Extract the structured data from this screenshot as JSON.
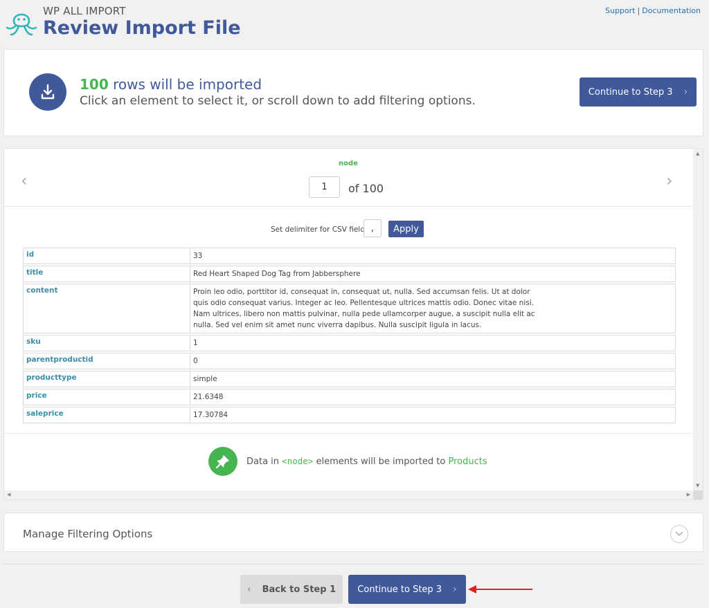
{
  "header": {
    "brand_small": "WP ALL IMPORT",
    "title": "Review Import File",
    "links": [
      "Support",
      "Documentation"
    ],
    "link_separator": "|"
  },
  "summary": {
    "count": "100",
    "line1_suffix": "rows will be imported",
    "line2": "Click an element to select it, or scroll down to add filtering options.",
    "continue_label": "Continue to Step 3",
    "icon": "download-icon"
  },
  "preview": {
    "node_name": "node",
    "current_record": "1",
    "total_text": "of 100",
    "delimiter_label": "Set delimiter for CSV fields:",
    "delimiter_value": ",",
    "apply_label": "Apply",
    "record": [
      {
        "key": "id",
        "value": "33"
      },
      {
        "key": "title",
        "value": "Red Heart Shaped Dog Tag from Jabbersphere"
      },
      {
        "key": "content",
        "value": "Proin leo odio, porttitor id, consequat in, consequat ut, nulla. Sed accumsan felis. Ut at dolor\nquis odio consequat varius. Integer ac leo. Pellentesque ultrices mattis odio. Donec vitae nisi.\nNam ultrices, libero non mattis pulvinar, nulla pede ullamcorper augue, a suscipit nulla elit ac\nnulla. Sed vel enim sit amet nunc viverra dapibus. Nulla suscipit ligula in lacus."
      },
      {
        "key": "sku",
        "value": "1"
      },
      {
        "key": "parentproductid",
        "value": "0"
      },
      {
        "key": "producttype",
        "value": "simple"
      },
      {
        "key": "price",
        "value": "21.6348"
      },
      {
        "key": "saleprice",
        "value": "17.30784"
      }
    ],
    "import_note": {
      "prefix": "Data in",
      "element": "<node>",
      "middle": "elements will be imported to",
      "target": "Products"
    }
  },
  "filtering": {
    "title": "Manage Filtering Options"
  },
  "footer": {
    "back_label": "Back to Step 1",
    "continue_label": "Continue to Step 3"
  },
  "colors": {
    "brand_blue": "#40599a",
    "success_green": "#46b450",
    "key_teal": "#3a8fa8",
    "annotation_red": "#e02020"
  }
}
